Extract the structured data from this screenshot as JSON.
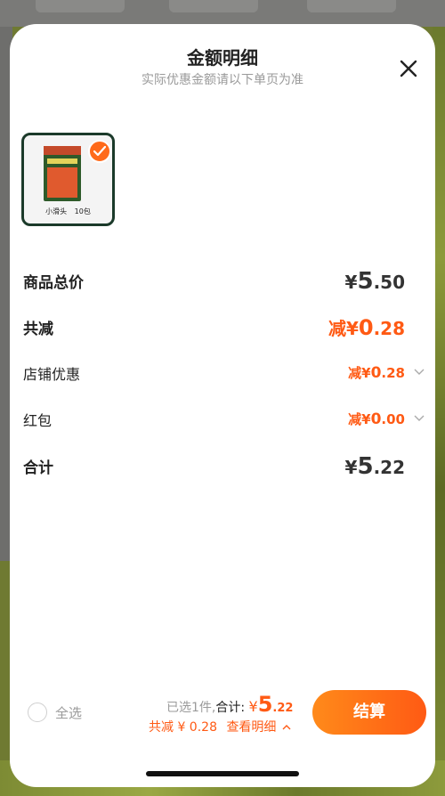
{
  "sheet": {
    "title": "金额明细",
    "subtitle": "实际优惠金额请以下单页为准"
  },
  "product": {
    "name": "小滑头",
    "qty": "10包",
    "selected": true
  },
  "rows": {
    "total": {
      "label": "商品总价",
      "symbol": "¥",
      "int": "5",
      "dec": ".50"
    },
    "reduce": {
      "label": "共减",
      "prefix": "减",
      "symbol": "¥",
      "int": "0",
      "dec": ".28"
    },
    "shop": {
      "label": "店铺优惠",
      "prefix": "减",
      "symbol": "¥",
      "int": "0",
      "dec": ".28"
    },
    "redpacket": {
      "label": "红包",
      "prefix": "减",
      "symbol": "¥",
      "int": "0",
      "dec": ".00"
    },
    "sum": {
      "label": "合计",
      "symbol": "¥",
      "int": "5",
      "dec": ".22"
    }
  },
  "footer": {
    "select_all": "全选",
    "selected_text": "已选1件,",
    "sum_label": "合计:",
    "currency": "¥",
    "sum_int": "5",
    "sum_dec": ".22",
    "discount_text": "共减 ¥ 0.28",
    "view_detail": "查看明细",
    "checkout": "结算"
  },
  "colors": {
    "accent": "#ff5a14",
    "checkout_gradient_start": "#ff8a1a",
    "text_dark": "#222222",
    "text_muted": "#9a9a9a"
  },
  "icons": [
    "close-icon",
    "check-icon",
    "chevron-down-icon",
    "chevron-up-icon"
  ]
}
